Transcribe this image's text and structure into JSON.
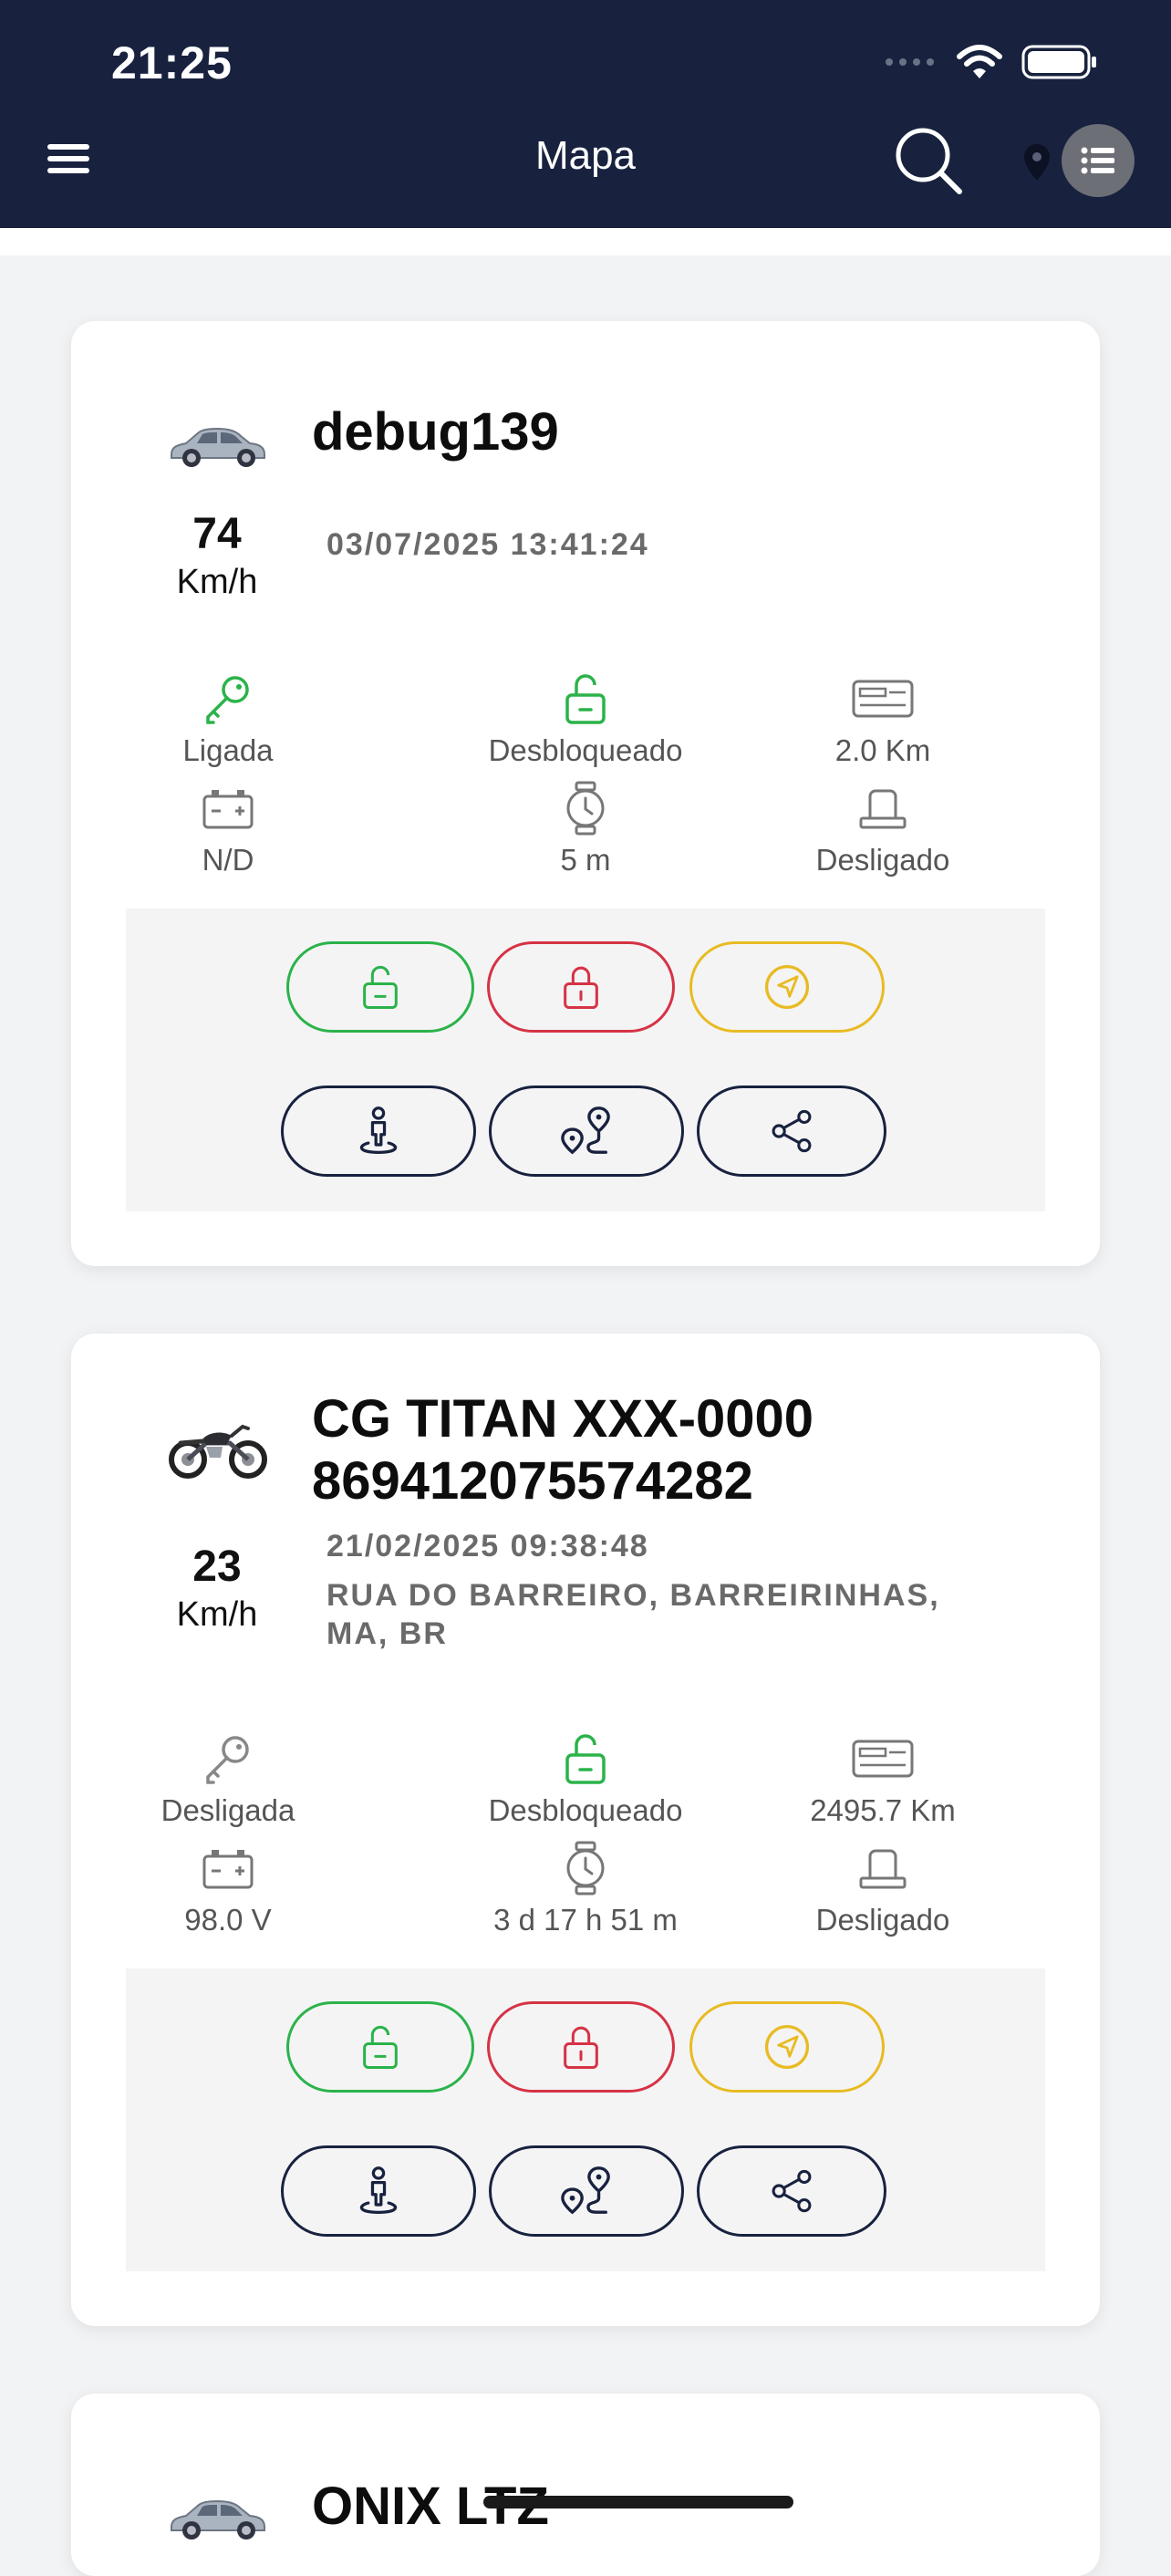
{
  "status_bar": {
    "time": "21:25"
  },
  "header": {
    "title": "Mapa"
  },
  "colors": {
    "header_bg": "#18223f",
    "green": "#2bb34a",
    "red": "#d63345",
    "yellow": "#e8bb23",
    "navy": "#18223f"
  },
  "vehicles": [
    {
      "name": "debug139",
      "vehicle_type": "car",
      "speed": "74",
      "speed_unit": "Km/h",
      "datetime": "03/07/2025 13:41:24",
      "address": "",
      "ignition": "Ligada",
      "lock": "Desbloqueado",
      "odometer": "2.0 Km",
      "battery": "N/D",
      "time_stopped": "5 m",
      "siren": "Desligado"
    },
    {
      "name": "CG TITAN XXX-0000 869412075574282",
      "vehicle_type": "motorcycle",
      "speed": "23",
      "speed_unit": "Km/h",
      "datetime": "21/02/2025 09:38:48",
      "address": "RUA DO BARREIRO, BARREIRINHAS, MA, BR",
      "ignition": "Desligada",
      "lock": "Desbloqueado",
      "odometer": "2495.7 Km",
      "battery": "98.0 V",
      "time_stopped": "3 d 17 h 51 m",
      "siren": "Desligado"
    },
    {
      "name": "ONIX LTZ",
      "vehicle_type": "car"
    }
  ]
}
